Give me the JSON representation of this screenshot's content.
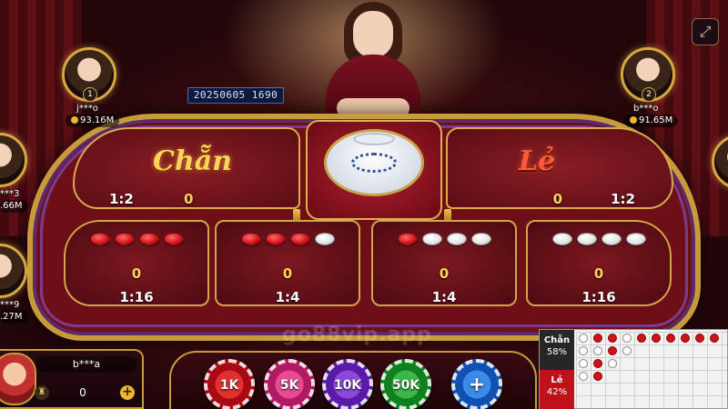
{
  "round": {
    "id": "20250605 1690"
  },
  "bets": {
    "chan": {
      "label": "Chẵn",
      "odds": "1:2",
      "value": "0"
    },
    "le": {
      "label": "Lẻ",
      "odds": "1:2",
      "value": "0"
    },
    "boxes": [
      {
        "pattern": [
          "red",
          "red",
          "red",
          "red"
        ],
        "value": "0",
        "odds": "1:16"
      },
      {
        "pattern": [
          "red",
          "red",
          "red",
          "white"
        ],
        "value": "0",
        "odds": "1:4"
      },
      {
        "pattern": [
          "red",
          "white",
          "white",
          "white"
        ],
        "value": "0",
        "odds": "1:4"
      },
      {
        "pattern": [
          "white",
          "white",
          "white",
          "white"
        ],
        "value": "0",
        "odds": "1:16"
      }
    ]
  },
  "players": [
    {
      "seat": "1",
      "name": "j***o",
      "coins": "93.16M"
    },
    {
      "seat": "2",
      "name": "b***o",
      "coins": "91.65M"
    },
    {
      "seat": "",
      "name": "***3",
      "coins": ".66M"
    },
    {
      "seat": "",
      "name": "***9",
      "coins": ".27M"
    }
  ],
  "user": {
    "name": "b***a",
    "balance": "0",
    "add_label": "+"
  },
  "chips": [
    "1K",
    "5K",
    "10K",
    "50K",
    "+"
  ],
  "history": {
    "chan_label": "Chẵn",
    "chan_pct": "58%",
    "le_label": "Lẻ",
    "le_pct": "42%"
  },
  "watermark": "go88vip.app",
  "colors": {
    "gold": "#d8ab4c",
    "felt": "#6e0f18",
    "red_coin": "#d0101a",
    "white_coin": "#ffffff"
  }
}
